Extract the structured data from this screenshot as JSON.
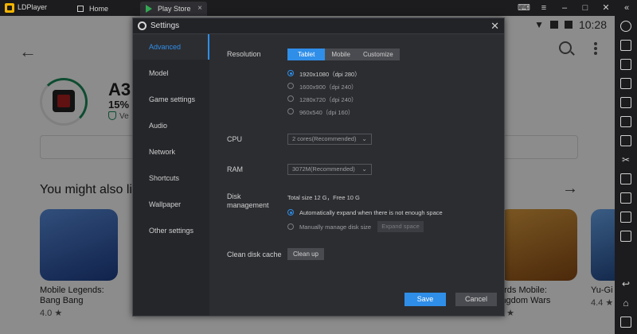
{
  "emulator": {
    "app_name": "LDPlayer",
    "tabs": [
      {
        "label": "Home"
      },
      {
        "label": "Play Store"
      }
    ]
  },
  "status_bar": {
    "time": "10:28"
  },
  "play_store": {
    "app_title": "A3:",
    "app_sub": "15% o",
    "verified": "Ve",
    "section_title": "You might also li",
    "cards": [
      {
        "name": "Mobile Legends: Bang Bang",
        "rating": "4.0 ★",
        "color": "#3a6fc0"
      },
      {
        "name": "ords Mobile: ingdom Wars",
        "rating": "3 ★",
        "color": "#c9822d"
      },
      {
        "name": "Yu-Gi",
        "rating": "4.4 ★",
        "color": "#3c7fd0"
      }
    ],
    "install_progress": 0.3
  },
  "settings": {
    "title": "Settings",
    "nav": [
      {
        "label": "Advanced",
        "active": true
      },
      {
        "label": "Model"
      },
      {
        "label": "Game settings"
      },
      {
        "label": "Audio"
      },
      {
        "label": "Network"
      },
      {
        "label": "Shortcuts"
      },
      {
        "label": "Wallpaper"
      },
      {
        "label": "Other settings"
      }
    ],
    "resolution": {
      "label": "Resolution",
      "modes": [
        "Tablet",
        "Mobile",
        "Customize"
      ],
      "selected_mode": "Tablet",
      "options": [
        "1920x1080（dpi 280）",
        "1600x900（dpi 240）",
        "1280x720（dpi 240）",
        "960x540（dpi 160）"
      ],
      "selected_index": 0
    },
    "cpu": {
      "label": "CPU",
      "value": "2 cores(Recommended)"
    },
    "ram": {
      "label": "RAM",
      "value": "3072M(Recommended)"
    },
    "disk": {
      "label": "Disk management",
      "summary": "Total size 12 G，Free 10 G",
      "auto": "Automatically expand when there is not enough space",
      "manual": "Manually manage disk size",
      "expand_btn": "Expand space"
    },
    "cache": {
      "label": "Clean disk cache",
      "button": "Clean up"
    },
    "save": "Save",
    "cancel": "Cancel"
  },
  "colors": {
    "accent": "#2f8ee8",
    "dialog_bg": "#2c2d31",
    "nav_bg": "#25262a"
  }
}
